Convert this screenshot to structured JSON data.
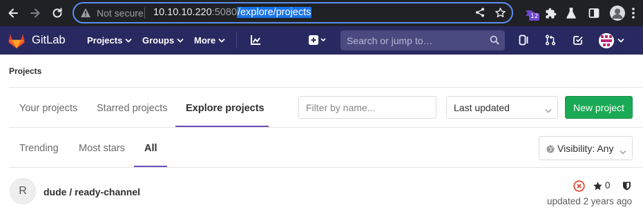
{
  "browser": {
    "security_label": "Not secure",
    "url_host": "10.10.10.220",
    "url_port": ":5080",
    "url_path": "/explore/projects",
    "extension_badge": "12",
    "icons": [
      "back-arrow-icon",
      "forward-arrow-icon",
      "reload-icon",
      "warning-icon",
      "share-icon",
      "bookmark-star-icon",
      "extension-icon",
      "puzzle-icon",
      "lab-flask-icon",
      "side-panel-icon",
      "profile-icon",
      "kebab-menu-icon"
    ]
  },
  "header": {
    "brand": "GitLab",
    "nav": {
      "projects": "Projects",
      "groups": "Groups",
      "more": "More"
    },
    "search_placeholder": "Search or jump to…",
    "icons": [
      "gitlab-logo-icon",
      "activity-chart-icon",
      "plus-square-icon",
      "search-icon",
      "issues-icon",
      "merge-request-icon",
      "todo-check-icon",
      "user-avatar-icon"
    ]
  },
  "breadcrumb": "Projects",
  "tabs": {
    "your": "Your projects",
    "starred": "Starred projects",
    "explore": "Explore projects"
  },
  "filter": {
    "placeholder": "Filter by name..."
  },
  "sort": {
    "selected": "Last updated"
  },
  "new_project_label": "New project",
  "subtabs": {
    "trending": "Trending",
    "most_stars": "Most stars",
    "all": "All"
  },
  "visibility": {
    "label": "Visibility: Any"
  },
  "project": {
    "avatar_letter": "R",
    "name": "dude / ready-channel",
    "stars": "0",
    "updated": "updated 2 years ago"
  },
  "colors": {
    "header_bg": "#292961",
    "accent": "#6b4fbb",
    "new_button": "#1aaa55",
    "url_highlight": "#1a73e8",
    "pipeline_failed": "#db3b21"
  }
}
